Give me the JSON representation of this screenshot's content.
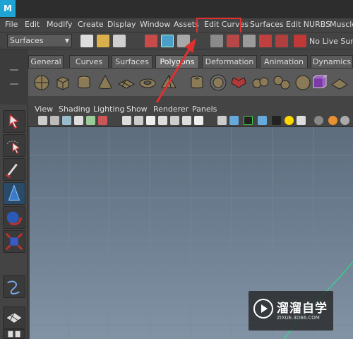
{
  "app": {
    "logo_letter": "M"
  },
  "menubar": {
    "items": [
      "File",
      "Edit",
      "Modify",
      "Create",
      "Display",
      "Window",
      "Assets",
      "Edit Curves",
      "Surfaces",
      "Edit NURBS",
      "Muscle"
    ]
  },
  "status_line": {
    "mode_value": "Surfaces",
    "live_surface_label": "No Live Surface"
  },
  "shelf": {
    "tabs": [
      "General",
      "Curves",
      "Surfaces",
      "Polygons",
      "Deformation",
      "Animation",
      "Dynamics"
    ],
    "active_tab": "Polygons"
  },
  "panel": {
    "menu": [
      "View",
      "Shading",
      "Lighting",
      "Show",
      "Renderer",
      "Panels"
    ]
  },
  "watermark": {
    "title": "溜溜自学",
    "url": "ZIXUE.3D66.COM"
  },
  "colors": {
    "highlight": "#e03030",
    "maya_blue": "#1fa3d4",
    "viewport_top": "#5d6d7e",
    "viewport_bottom": "#8193a4"
  },
  "icons": {
    "toolbox": [
      "select-arrow-icon",
      "lasso-select-icon",
      "paint-select-icon",
      "move-tool-icon",
      "rotate-tool-icon",
      "scale-tool-icon",
      "curve-tool-icon",
      "grid-layout-icon"
    ],
    "shelf": [
      "poly-sphere-icon",
      "poly-cube-icon",
      "poly-cylinder-icon",
      "poly-cone-icon",
      "poly-plane-icon",
      "poly-torus-icon",
      "poly-pyramid-icon",
      "poly-pipe-icon",
      "poly-helix-icon"
    ]
  }
}
